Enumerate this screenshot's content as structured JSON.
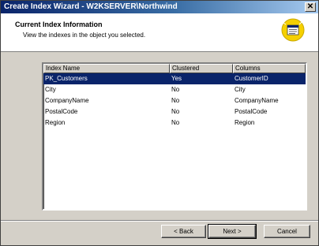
{
  "window": {
    "title": "Create Index Wizard - W2KSERVER\\Northwind",
    "close_glyph": "✕"
  },
  "header": {
    "title": "Current Index Information",
    "subtitle": "View the indexes in the object you selected.",
    "icon": "wizard-index-icon"
  },
  "table": {
    "columns": [
      "Index Name",
      "Clustered",
      "Columns"
    ],
    "rows": [
      [
        "PK_Customers",
        "Yes",
        "CustomerID"
      ],
      [
        "City",
        "No",
        "City"
      ],
      [
        "CompanyName",
        "No",
        "CompanyName"
      ],
      [
        "PostalCode",
        "No",
        "PostalCode"
      ],
      [
        "Region",
        "No",
        "Region"
      ]
    ],
    "selected_row": 0
  },
  "buttons": {
    "back": "< Back",
    "next": "Next >",
    "cancel": "Cancel"
  },
  "colors": {
    "title_start": "#0a246a",
    "title_end": "#a6caf0",
    "selection": "#0a246a",
    "face": "#d4d0c8",
    "icon_circle": "#f5d000"
  }
}
